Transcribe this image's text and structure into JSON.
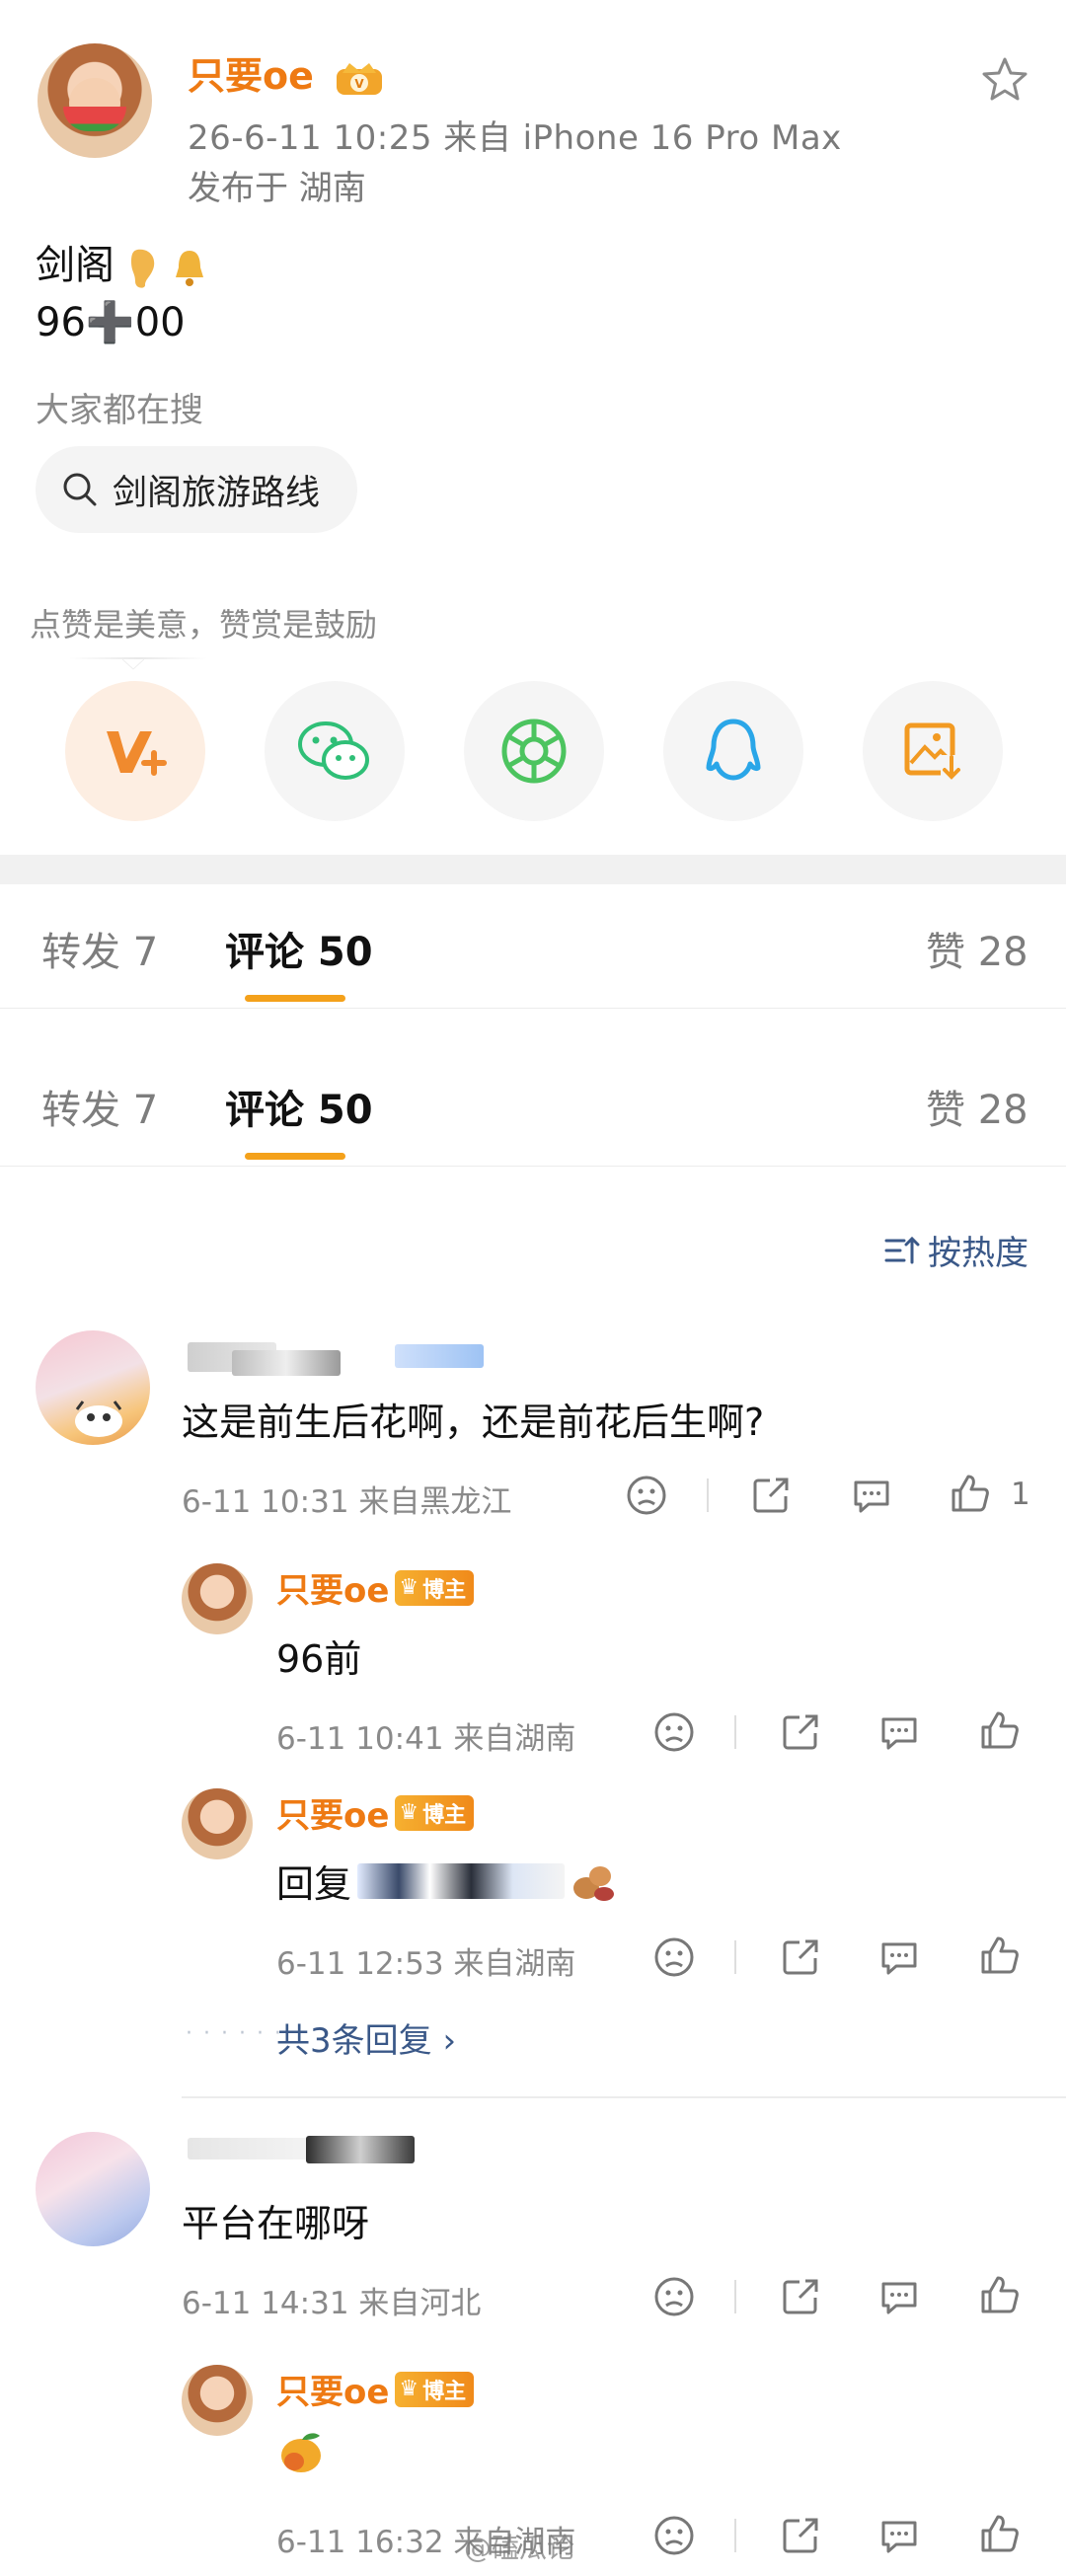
{
  "post": {
    "author": "只要oe",
    "meta_line1": "26-6-11 10:25  来自 iPhone 16 Pro Max",
    "meta_line2": "发布于 湖南",
    "body_line1": "剑阁",
    "body_line2": "96➕00",
    "hot_search_title": "大家都在搜",
    "hot_search_query": "剑阁旅游路线",
    "reward_tip": "点赞是美意，赞赏是鼓励",
    "share_targets": [
      "weibo-vip-icon",
      "wechat-icon",
      "moments-icon",
      "qq-icon",
      "save-image-icon"
    ]
  },
  "tabs": {
    "repost": "转发 7",
    "comment": "评论 50",
    "like": "赞 28"
  },
  "sort_label": "按热度",
  "comments": [
    {
      "text": "这是前生后花啊，还是前花后生啊?",
      "meta": "6-11 10:31  来自黑龙江",
      "like_count": "1",
      "replies": [
        {
          "author": "只要oe",
          "badge": "博主",
          "text": "96前",
          "meta": "6-11 10:41  来自湖南"
        },
        {
          "author": "只要oe",
          "badge": "博主",
          "text": "回复",
          "meta": "6-11 12:53  来自湖南"
        }
      ],
      "more_replies": "共3条回复 ›"
    },
    {
      "text": "平台在哪呀",
      "meta": "6-11 14:31  来自河北",
      "replies": [
        {
          "author": "只要oe",
          "badge": "博主",
          "text": "🥭",
          "meta": "6-11 16:32  来自湖南"
        }
      ]
    }
  ],
  "watermark": "@磕瓜论",
  "colors": {
    "accent": "#ee7a13",
    "link": "#3a5888",
    "tab_indicator": "#f4a11b"
  }
}
